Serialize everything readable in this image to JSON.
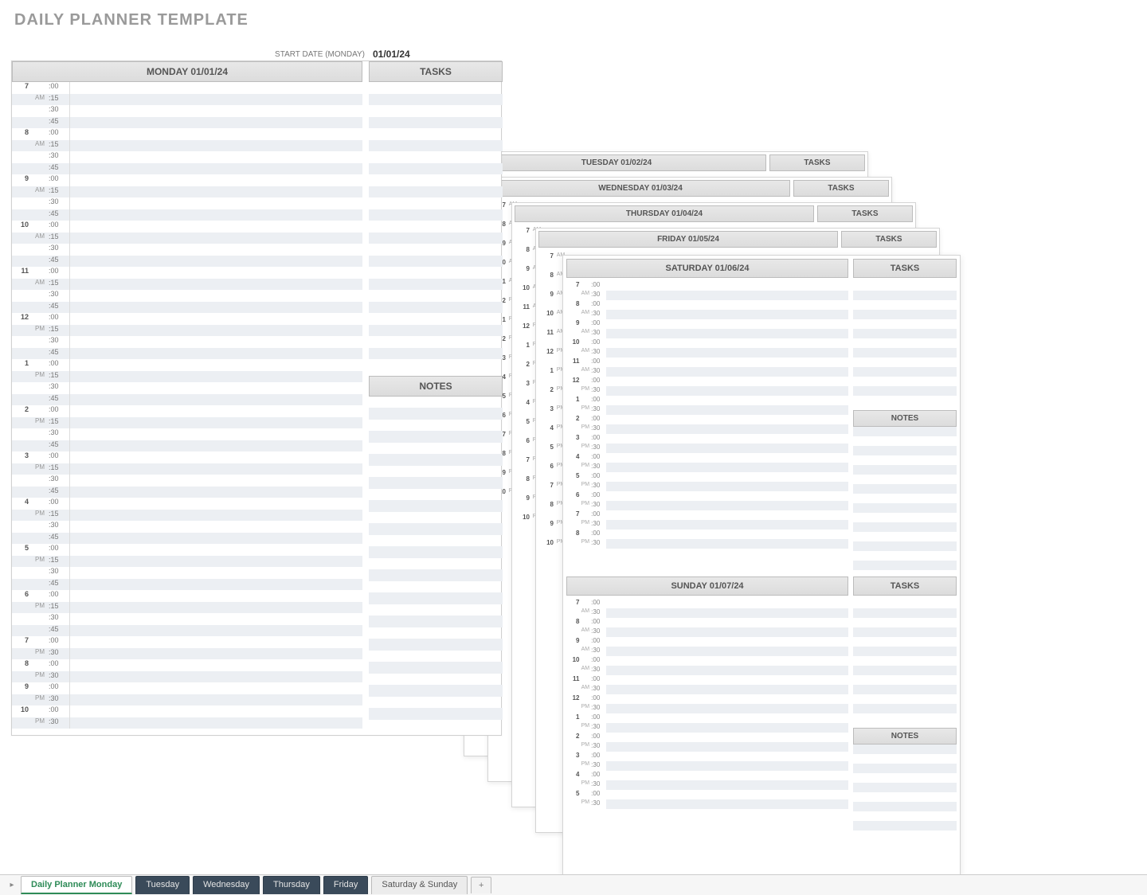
{
  "title": "DAILY PLANNER TEMPLATE",
  "start_date": {
    "label": "START DATE (MONDAY)",
    "value": "01/01/24"
  },
  "monday": {
    "day_header": "MONDAY 01/01/24",
    "tasks_header": "TASKS",
    "notes_header": "NOTES",
    "hours_15": [
      {
        "h": "7",
        "ampm": "AM"
      },
      {
        "h": "8",
        "ampm": "AM"
      },
      {
        "h": "9",
        "ampm": "AM"
      },
      {
        "h": "10",
        "ampm": "AM"
      },
      {
        "h": "11",
        "ampm": "AM"
      },
      {
        "h": "12",
        "ampm": "PM"
      },
      {
        "h": "1",
        "ampm": "PM"
      },
      {
        "h": "2",
        "ampm": "PM"
      },
      {
        "h": "3",
        "ampm": "PM"
      },
      {
        "h": "4",
        "ampm": "PM"
      },
      {
        "h": "5",
        "ampm": "PM"
      },
      {
        "h": "6",
        "ampm": "PM"
      }
    ],
    "hours_30": [
      {
        "h": "7",
        "ampm": "PM"
      },
      {
        "h": "8",
        "ampm": "PM"
      },
      {
        "h": "9",
        "ampm": "PM"
      },
      {
        "h": "10",
        "ampm": "PM"
      }
    ],
    "mins15": [
      ":00",
      ":15",
      ":30",
      ":45"
    ],
    "mins30": [
      ":00",
      ":30"
    ]
  },
  "bg_days": [
    {
      "day_header": "TUESDAY 01/02/24",
      "tasks_header": "TASKS"
    },
    {
      "day_header": "WEDNESDAY 01/03/24",
      "tasks_header": "TASKS"
    },
    {
      "day_header": "THURSDAY 01/04/24",
      "tasks_header": "TASKS"
    },
    {
      "day_header": "FRIDAY 01/05/24",
      "tasks_header": "TASKS"
    }
  ],
  "bg_hours": [
    {
      "h": "7",
      "ampm": "AM"
    },
    {
      "h": "8",
      "ampm": "AM"
    },
    {
      "h": "9",
      "ampm": "AM"
    },
    {
      "h": "10",
      "ampm": "AM"
    },
    {
      "h": "11",
      "ampm": "AM"
    },
    {
      "h": "12",
      "ampm": "PM"
    },
    {
      "h": "1",
      "ampm": "PM"
    },
    {
      "h": "2",
      "ampm": "PM"
    },
    {
      "h": "3",
      "ampm": "PM"
    },
    {
      "h": "4",
      "ampm": "PM"
    },
    {
      "h": "5",
      "ampm": "PM"
    },
    {
      "h": "6",
      "ampm": "PM"
    },
    {
      "h": "7",
      "ampm": "PM"
    },
    {
      "h": "8",
      "ampm": "PM"
    },
    {
      "h": "9",
      "ampm": "PM"
    },
    {
      "h": "10",
      "ampm": "PM"
    }
  ],
  "weekend": {
    "sat_header": "SATURDAY 01/06/24",
    "sun_header": "SUNDAY 01/07/24",
    "tasks_header": "TASKS",
    "notes_header": "NOTES",
    "hours": [
      {
        "h": "7",
        "ampm": "AM"
      },
      {
        "h": "8",
        "ampm": "AM"
      },
      {
        "h": "9",
        "ampm": "AM"
      },
      {
        "h": "10",
        "ampm": "AM"
      },
      {
        "h": "11",
        "ampm": "AM"
      },
      {
        "h": "12",
        "ampm": "PM"
      },
      {
        "h": "1",
        "ampm": "PM"
      },
      {
        "h": "2",
        "ampm": "PM"
      },
      {
        "h": "3",
        "ampm": "PM"
      },
      {
        "h": "4",
        "ampm": "PM"
      },
      {
        "h": "5",
        "ampm": "PM"
      },
      {
        "h": "6",
        "ampm": "PM"
      },
      {
        "h": "7",
        "ampm": "PM"
      },
      {
        "h": "8",
        "ampm": "PM"
      }
    ],
    "sun_hours": [
      {
        "h": "7",
        "ampm": "AM"
      },
      {
        "h": "8",
        "ampm": "AM"
      },
      {
        "h": "9",
        "ampm": "AM"
      },
      {
        "h": "10",
        "ampm": "AM"
      },
      {
        "h": "11",
        "ampm": "AM"
      },
      {
        "h": "12",
        "ampm": "PM"
      },
      {
        "h": "1",
        "ampm": "PM"
      },
      {
        "h": "2",
        "ampm": "PM"
      },
      {
        "h": "3",
        "ampm": "PM"
      },
      {
        "h": "4",
        "ampm": "PM"
      },
      {
        "h": "5",
        "ampm": "PM"
      }
    ],
    "mins30": [
      ":00",
      ":30"
    ]
  },
  "tabs": [
    {
      "label": "Daily Planner Monday",
      "kind": "active"
    },
    {
      "label": "Tuesday",
      "kind": "dark"
    },
    {
      "label": "Wednesday",
      "kind": "dark"
    },
    {
      "label": "Thursday",
      "kind": "dark"
    },
    {
      "label": "Friday",
      "kind": "dark"
    },
    {
      "label": "Saturday & Sunday",
      "kind": "plain"
    }
  ],
  "addtab": "+"
}
